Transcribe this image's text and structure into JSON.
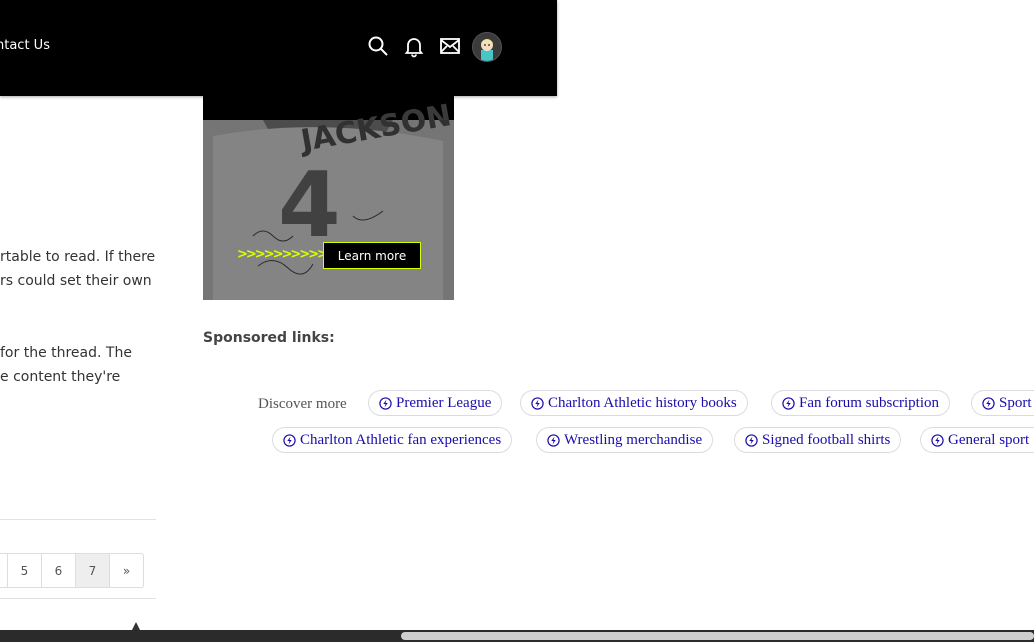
{
  "header": {
    "nav_link": "ntact Us",
    "icons": [
      "search-icon",
      "bell-icon",
      "envelope-icon",
      "user-avatar"
    ]
  },
  "ad": {
    "button_label": "Learn more",
    "arrows": ">>>>>>>>>>",
    "accent_color": "#d9ff00"
  },
  "post": {
    "lines_a": [
      "rtable to read. If there",
      "rs could set their own"
    ],
    "lines_b": [
      "for the thread. The",
      "e content they're"
    ]
  },
  "sponsored": {
    "label": "Sponsored links:",
    "discover_label": "Discover more",
    "chips_row1": [
      "Premier League",
      "Charlton Athletic history books",
      "Fan forum subscription",
      "Sport"
    ],
    "chips_row2": [
      "Charlton Athletic fan experiences",
      "Wrestling merchandise",
      "Signed football shirts",
      "General sport"
    ],
    "link_color": "#1a0dab"
  },
  "pagination": {
    "pages": [
      "5",
      "6",
      "7"
    ],
    "current": "7",
    "next": "»"
  }
}
